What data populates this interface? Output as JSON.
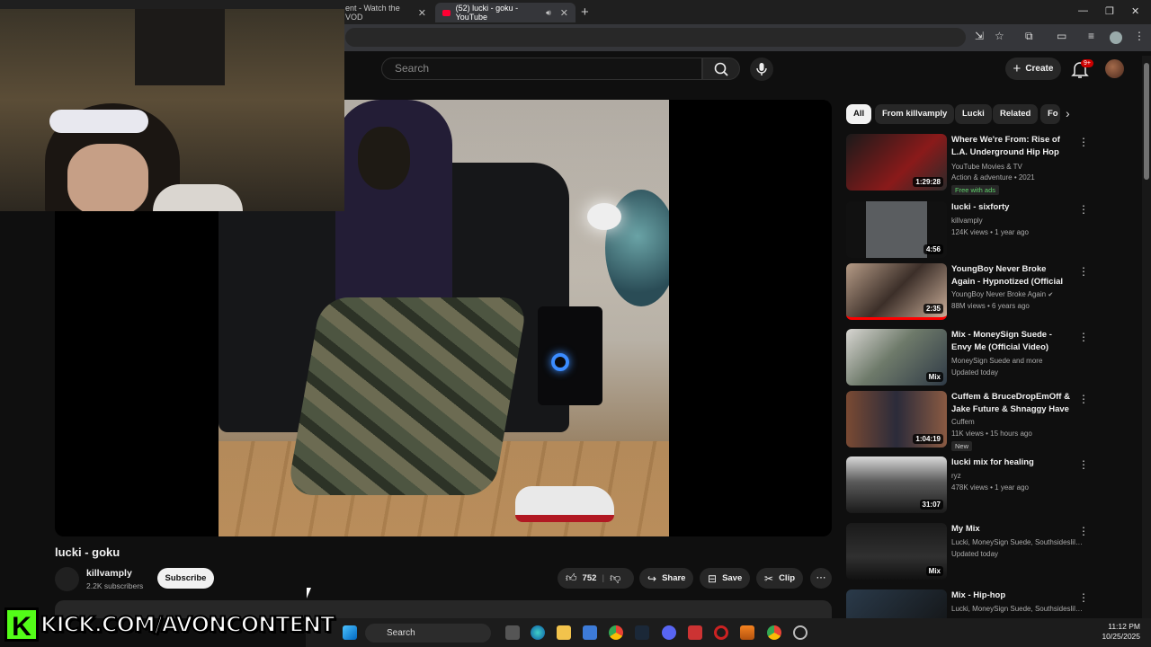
{
  "browser": {
    "tabs": [
      {
        "label": "ent - Watch the VOD"
      },
      {
        "label": "(52) lucki - goku - YouTube"
      }
    ],
    "new_tab": "+",
    "window_controls": {
      "minimize": "—",
      "restore": "❐",
      "close": "✕"
    }
  },
  "header": {
    "search_placeholder": "Search",
    "create_label": "Create",
    "notification_badge": "9+"
  },
  "video": {
    "title": "lucki - goku",
    "channel": "killvamply",
    "subscribers": "2.2K subscribers",
    "subscribe_label": "Subscribe",
    "likes": "752",
    "share_label": "Share",
    "save_label": "Save",
    "clip_label": "Clip"
  },
  "chips": [
    "All",
    "From killvamply",
    "Lucki",
    "Related",
    "Fo"
  ],
  "recommendations": [
    {
      "title": "Where We're From: Rise of L.A. Underground Hip Hop",
      "meta1": "YouTube Movies & TV",
      "meta2": "Action & adventure • 2021",
      "badge": "Free with ads",
      "duration": "1:29:28"
    },
    {
      "title": "lucki - sixforty",
      "meta1": "killvamply",
      "meta2": "124K views • 1 year ago",
      "duration": "4:56"
    },
    {
      "title": "YoungBoy Never Broke Again - Hypnotized (Official Video)",
      "meta1": "YoungBoy Never Broke Again",
      "meta2": "88M views • 6 years ago",
      "duration": "2:35"
    },
    {
      "title": "Mix - MoneySign Suede - Envy Me (Official Video)",
      "meta1": "MoneySign Suede and more",
      "meta2": "Updated today",
      "duration": "Mix"
    },
    {
      "title": "Cuffem & BruceDropEmOff & Jake Future & Shnaggy Have ...",
      "meta1": "Cuffem",
      "meta2": "11K views • 15 hours ago",
      "badge": "New",
      "duration": "1:04:19"
    },
    {
      "title": "lucki mix for healing",
      "meta1": "ryz",
      "meta2": "478K views • 1 year ago",
      "duration": "31:07"
    },
    {
      "title": "My Mix",
      "meta1": "Lucki, MoneySign Suede, Southsideslilho...",
      "meta2": "Updated today",
      "duration": "Mix"
    },
    {
      "title": "Mix - Hip-hop",
      "meta1": "Lucki, MoneySign Suede, Southsideslilho...",
      "meta2": "",
      "duration": ""
    }
  ],
  "overlay": {
    "kick_text": "KICK.COM/AVONCONTENT",
    "kick_logo": "K"
  },
  "taskbar": {
    "search_label": "Search",
    "time": "11:12 PM",
    "date": "10/25/2025"
  },
  "colors": {
    "youtube_red": "#ff0033",
    "kick_green": "#53fc18",
    "background": "#0f0f0f"
  }
}
